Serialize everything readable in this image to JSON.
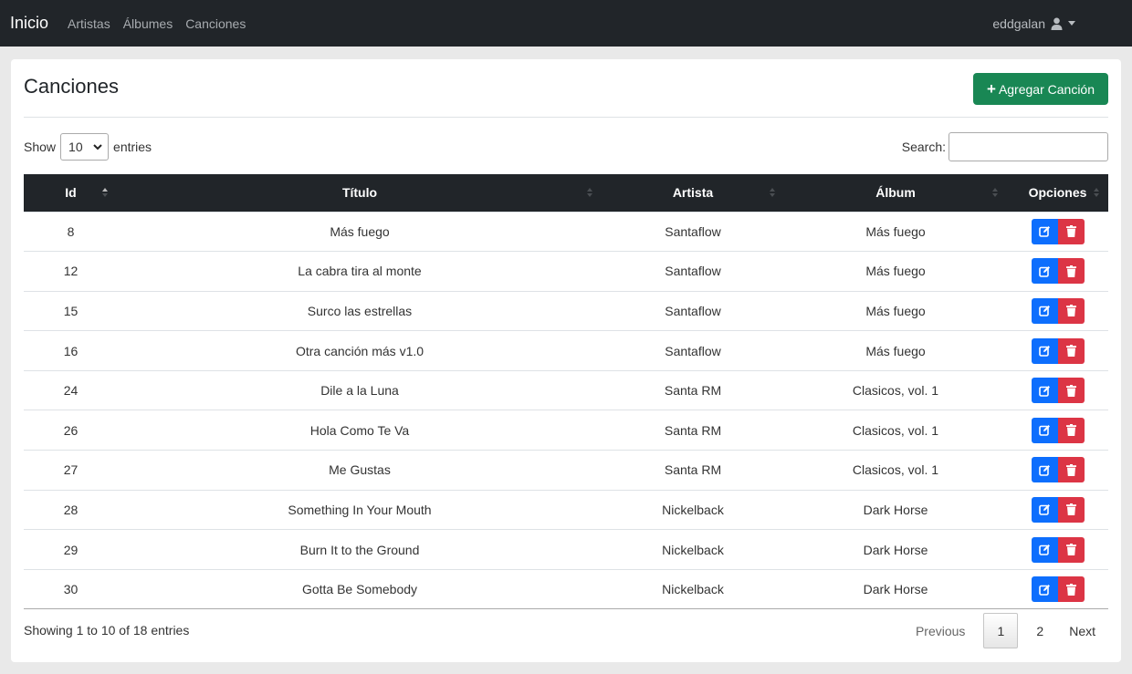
{
  "nav": {
    "brand": "Inicio",
    "links": [
      "Artistas",
      "Álbumes",
      "Canciones"
    ],
    "user": "eddgalan"
  },
  "header": {
    "title": "Canciones",
    "add_label": "Agregar Canción"
  },
  "controls": {
    "show_label": "Show",
    "entries_value": "10",
    "entries_label": "entries",
    "search_label": "Search:",
    "search_value": ""
  },
  "table": {
    "columns": [
      "Id",
      "Título",
      "Artista",
      "Álbum",
      "Opciones"
    ],
    "rows": [
      {
        "id": "8",
        "titulo": "Más fuego",
        "artista": "Santaflow",
        "album": "Más fuego"
      },
      {
        "id": "12",
        "titulo": "La cabra tira al monte",
        "artista": "Santaflow",
        "album": "Más fuego"
      },
      {
        "id": "15",
        "titulo": "Surco las estrellas",
        "artista": "Santaflow",
        "album": "Más fuego"
      },
      {
        "id": "16",
        "titulo": "Otra canción más v1.0",
        "artista": "Santaflow",
        "album": "Más fuego"
      },
      {
        "id": "24",
        "titulo": "Dile a la Luna",
        "artista": "Santa RM",
        "album": "Clasicos, vol. 1"
      },
      {
        "id": "26",
        "titulo": "Hola Como Te Va",
        "artista": "Santa RM",
        "album": "Clasicos, vol. 1"
      },
      {
        "id": "27",
        "titulo": "Me Gustas",
        "artista": "Santa RM",
        "album": "Clasicos, vol. 1"
      },
      {
        "id": "28",
        "titulo": "Something In Your Mouth",
        "artista": "Nickelback",
        "album": "Dark Horse"
      },
      {
        "id": "29",
        "titulo": "Burn It to the Ground",
        "artista": "Nickelback",
        "album": "Dark Horse"
      },
      {
        "id": "30",
        "titulo": "Gotta Be Somebody",
        "artista": "Nickelback",
        "album": "Dark Horse"
      }
    ]
  },
  "footer": {
    "info": "Showing 1 to 10 of 18 entries",
    "previous": "Previous",
    "pages": [
      "1",
      "2"
    ],
    "next": "Next"
  },
  "icons": {
    "user": "user-icon",
    "edit": "edit-icon",
    "delete": "trash-icon",
    "add": "plus-icon"
  },
  "colors": {
    "navbar": "#212529",
    "success": "#198754",
    "primary": "#0d6efd",
    "danger": "#dc3545"
  }
}
